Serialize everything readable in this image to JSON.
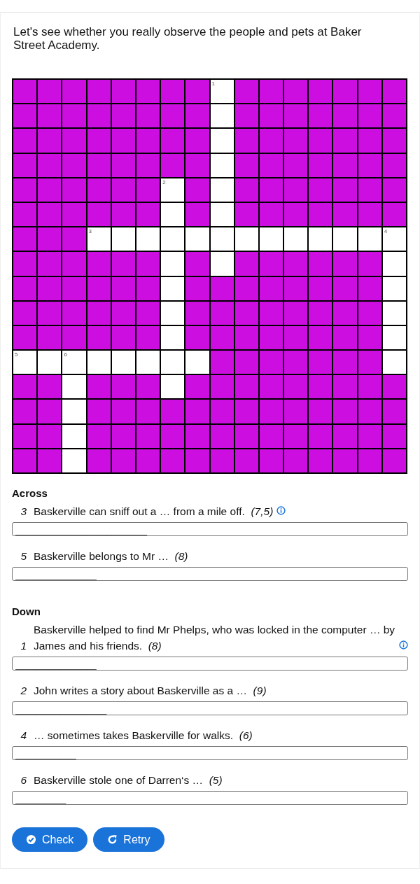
{
  "intro": "Let's see whether you really observe the people and pets at Baker Street Academy.",
  "grid": {
    "rows": [
      {
        "cells": [
          {
            "open": false
          },
          {
            "open": false
          },
          {
            "open": false
          },
          {
            "open": false
          },
          {
            "open": false
          },
          {
            "open": false
          },
          {
            "open": false
          },
          {
            "open": false
          },
          {
            "open": true,
            "number": "1"
          },
          {
            "open": false
          },
          {
            "open": false
          },
          {
            "open": false
          },
          {
            "open": false
          },
          {
            "open": false
          },
          {
            "open": false
          },
          {
            "open": false
          }
        ]
      },
      {
        "cells": [
          {
            "open": false
          },
          {
            "open": false
          },
          {
            "open": false
          },
          {
            "open": false
          },
          {
            "open": false
          },
          {
            "open": false
          },
          {
            "open": false
          },
          {
            "open": false
          },
          {
            "open": true
          },
          {
            "open": false
          },
          {
            "open": false
          },
          {
            "open": false
          },
          {
            "open": false
          },
          {
            "open": false
          },
          {
            "open": false
          },
          {
            "open": false
          }
        ]
      },
      {
        "cells": [
          {
            "open": false
          },
          {
            "open": false
          },
          {
            "open": false
          },
          {
            "open": false
          },
          {
            "open": false
          },
          {
            "open": false
          },
          {
            "open": false
          },
          {
            "open": false
          },
          {
            "open": true
          },
          {
            "open": false
          },
          {
            "open": false
          },
          {
            "open": false
          },
          {
            "open": false
          },
          {
            "open": false
          },
          {
            "open": false
          },
          {
            "open": false
          }
        ]
      },
      {
        "cells": [
          {
            "open": false
          },
          {
            "open": false
          },
          {
            "open": false
          },
          {
            "open": false
          },
          {
            "open": false
          },
          {
            "open": false
          },
          {
            "open": false
          },
          {
            "open": false
          },
          {
            "open": true
          },
          {
            "open": false
          },
          {
            "open": false
          },
          {
            "open": false
          },
          {
            "open": false
          },
          {
            "open": false
          },
          {
            "open": false
          },
          {
            "open": false
          }
        ]
      },
      {
        "cells": [
          {
            "open": false
          },
          {
            "open": false
          },
          {
            "open": false
          },
          {
            "open": false
          },
          {
            "open": false
          },
          {
            "open": false
          },
          {
            "open": true,
            "number": "2"
          },
          {
            "open": false
          },
          {
            "open": true
          },
          {
            "open": false
          },
          {
            "open": false
          },
          {
            "open": false
          },
          {
            "open": false
          },
          {
            "open": false
          },
          {
            "open": false
          },
          {
            "open": false
          }
        ]
      },
      {
        "cells": [
          {
            "open": false
          },
          {
            "open": false
          },
          {
            "open": false
          },
          {
            "open": false
          },
          {
            "open": false
          },
          {
            "open": false
          },
          {
            "open": true
          },
          {
            "open": false
          },
          {
            "open": true
          },
          {
            "open": false
          },
          {
            "open": false
          },
          {
            "open": false
          },
          {
            "open": false
          },
          {
            "open": false
          },
          {
            "open": false
          },
          {
            "open": false
          }
        ]
      },
      {
        "cells": [
          {
            "open": false
          },
          {
            "open": false
          },
          {
            "open": false
          },
          {
            "open": true,
            "number": "3"
          },
          {
            "open": true
          },
          {
            "open": true
          },
          {
            "open": true
          },
          {
            "open": true
          },
          {
            "open": true
          },
          {
            "open": true
          },
          {
            "open": true
          },
          {
            "open": true
          },
          {
            "open": true
          },
          {
            "open": true
          },
          {
            "open": true
          },
          {
            "open": true,
            "number": "4"
          }
        ]
      },
      {
        "cells": [
          {
            "open": false
          },
          {
            "open": false
          },
          {
            "open": false
          },
          {
            "open": false
          },
          {
            "open": false
          },
          {
            "open": false
          },
          {
            "open": true
          },
          {
            "open": false
          },
          {
            "open": true
          },
          {
            "open": false
          },
          {
            "open": false
          },
          {
            "open": false
          },
          {
            "open": false
          },
          {
            "open": false
          },
          {
            "open": false
          },
          {
            "open": true
          }
        ]
      },
      {
        "cells": [
          {
            "open": false
          },
          {
            "open": false
          },
          {
            "open": false
          },
          {
            "open": false
          },
          {
            "open": false
          },
          {
            "open": false
          },
          {
            "open": true
          },
          {
            "open": false
          },
          {
            "open": false
          },
          {
            "open": false
          },
          {
            "open": false
          },
          {
            "open": false
          },
          {
            "open": false
          },
          {
            "open": false
          },
          {
            "open": false
          },
          {
            "open": true
          }
        ]
      },
      {
        "cells": [
          {
            "open": false
          },
          {
            "open": false
          },
          {
            "open": false
          },
          {
            "open": false
          },
          {
            "open": false
          },
          {
            "open": false
          },
          {
            "open": true
          },
          {
            "open": false
          },
          {
            "open": false
          },
          {
            "open": false
          },
          {
            "open": false
          },
          {
            "open": false
          },
          {
            "open": false
          },
          {
            "open": false
          },
          {
            "open": false
          },
          {
            "open": true
          }
        ]
      },
      {
        "cells": [
          {
            "open": false
          },
          {
            "open": false
          },
          {
            "open": false
          },
          {
            "open": false
          },
          {
            "open": false
          },
          {
            "open": false
          },
          {
            "open": true
          },
          {
            "open": false
          },
          {
            "open": false
          },
          {
            "open": false
          },
          {
            "open": false
          },
          {
            "open": false
          },
          {
            "open": false
          },
          {
            "open": false
          },
          {
            "open": false
          },
          {
            "open": true
          }
        ]
      },
      {
        "cells": [
          {
            "open": true,
            "number": "5"
          },
          {
            "open": true
          },
          {
            "open": true,
            "number": "6"
          },
          {
            "open": true
          },
          {
            "open": true
          },
          {
            "open": true
          },
          {
            "open": true
          },
          {
            "open": true
          },
          {
            "open": false
          },
          {
            "open": false
          },
          {
            "open": false
          },
          {
            "open": false
          },
          {
            "open": false
          },
          {
            "open": false
          },
          {
            "open": false
          },
          {
            "open": true
          }
        ]
      },
      {
        "cells": [
          {
            "open": false
          },
          {
            "open": false
          },
          {
            "open": true
          },
          {
            "open": false
          },
          {
            "open": false
          },
          {
            "open": false
          },
          {
            "open": true
          },
          {
            "open": false
          },
          {
            "open": false
          },
          {
            "open": false
          },
          {
            "open": false
          },
          {
            "open": false
          },
          {
            "open": false
          },
          {
            "open": false
          },
          {
            "open": false
          },
          {
            "open": false
          }
        ]
      },
      {
        "cells": [
          {
            "open": false
          },
          {
            "open": false
          },
          {
            "open": true
          },
          {
            "open": false
          },
          {
            "open": false
          },
          {
            "open": false
          },
          {
            "open": false
          },
          {
            "open": false
          },
          {
            "open": false
          },
          {
            "open": false
          },
          {
            "open": false
          },
          {
            "open": false
          },
          {
            "open": false
          },
          {
            "open": false
          },
          {
            "open": false
          },
          {
            "open": false
          }
        ]
      },
      {
        "cells": [
          {
            "open": false
          },
          {
            "open": false
          },
          {
            "open": true
          },
          {
            "open": false
          },
          {
            "open": false
          },
          {
            "open": false
          },
          {
            "open": false
          },
          {
            "open": false
          },
          {
            "open": false
          },
          {
            "open": false
          },
          {
            "open": false
          },
          {
            "open": false
          },
          {
            "open": false
          },
          {
            "open": false
          },
          {
            "open": false
          },
          {
            "open": false
          }
        ]
      },
      {
        "cells": [
          {
            "open": false
          },
          {
            "open": false
          },
          {
            "open": true
          },
          {
            "open": false
          },
          {
            "open": false
          },
          {
            "open": false
          },
          {
            "open": false
          },
          {
            "open": false
          },
          {
            "open": false
          },
          {
            "open": false
          },
          {
            "open": false
          },
          {
            "open": false
          },
          {
            "open": false
          },
          {
            "open": false
          },
          {
            "open": false
          },
          {
            "open": false
          }
        ]
      }
    ]
  },
  "sections": [
    {
      "heading": "Across",
      "clues": [
        {
          "number": "3",
          "text": "Baskerville can sniff out a … from a mile off.  *(7,5)*",
          "info": true,
          "placeholder": "__________________________"
        },
        {
          "number": "5",
          "text": "Baskerville belongs to Mr …  *(8)*",
          "info": false,
          "placeholder": "________________"
        }
      ]
    },
    {
      "heading": "Down",
      "clues": [
        {
          "number": "1",
          "text": "Baskerville helped to find Mr Phelps, who was locked in the computer … by James and his friends.  *(8)*",
          "info": true,
          "placeholder": "________________"
        },
        {
          "number": "2",
          "text": "John writes a story about Baskerville as a …  *(9)*",
          "info": false,
          "placeholder": "__________________"
        },
        {
          "number": "4",
          "text": "… sometimes takes Baskerville for walks.  *(6)*",
          "info": false,
          "placeholder": "____________"
        },
        {
          "number": "6",
          "text": "Baskerville stole one of Darren‘s …  *(5)*",
          "info": false,
          "placeholder": "__________"
        }
      ]
    }
  ],
  "buttons": [
    {
      "kind": "check",
      "label": "Check"
    },
    {
      "kind": "retry",
      "label": "Retry"
    }
  ]
}
